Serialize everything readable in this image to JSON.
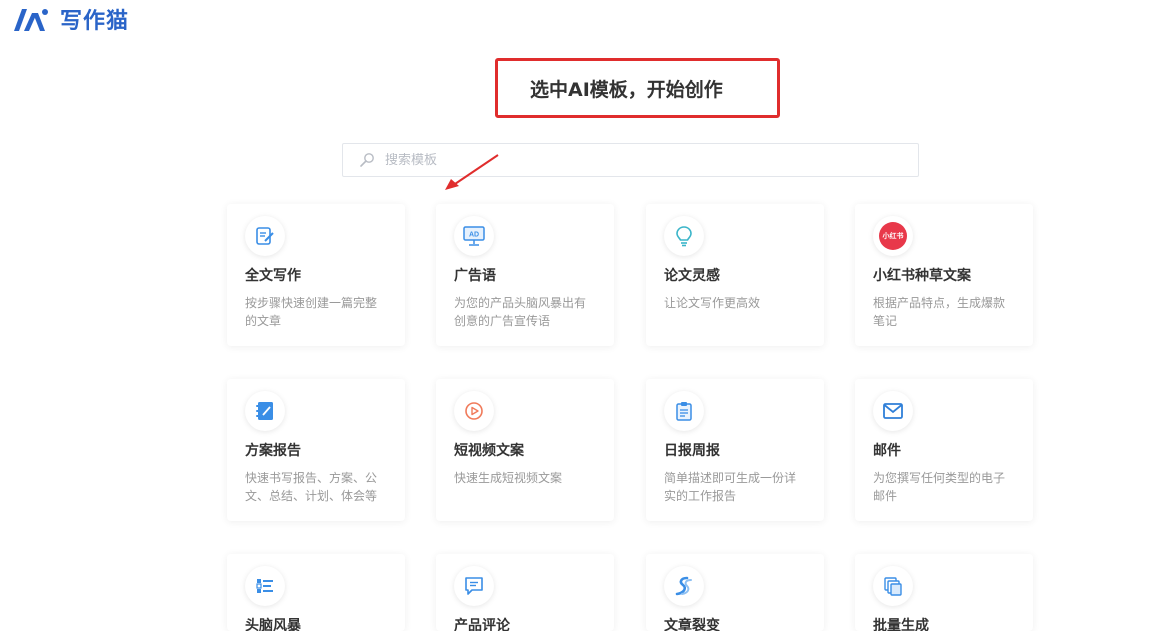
{
  "brand": {
    "name": "写作猫"
  },
  "callout": {
    "text": "选中AI模板，开始创作"
  },
  "search": {
    "placeholder": "搜索模板"
  },
  "templates": [
    {
      "title": "全文写作",
      "desc": "按步骤快速创建一篇完整的文章",
      "icon": "edit-document-icon"
    },
    {
      "title": "广告语",
      "desc": "为您的产品头脑风暴出有创意的广告宣传语",
      "icon": "ad-screen-icon"
    },
    {
      "title": "论文灵感",
      "desc": "让论文写作更高效",
      "icon": "lightbulb-icon"
    },
    {
      "title": "小红书种草文案",
      "desc": "根据产品特点，生成爆款笔记",
      "icon": "xiaohongshu-icon",
      "icon_text": "小红书"
    },
    {
      "title": "方案报告",
      "desc": "快速书写报告、方案、公文、总结、计划、体会等",
      "icon": "notebook-icon"
    },
    {
      "title": "短视频文案",
      "desc": "快速生成短视频文案",
      "icon": "play-icon"
    },
    {
      "title": "日报周报",
      "desc": "简单描述即可生成一份详实的工作报告",
      "icon": "clipboard-icon"
    },
    {
      "title": "邮件",
      "desc": "为您撰写任何类型的电子邮件",
      "icon": "mail-icon"
    },
    {
      "title": "头脑风暴",
      "desc": "",
      "icon": "list-icon"
    },
    {
      "title": "产品评论",
      "desc": "",
      "icon": "comment-icon"
    },
    {
      "title": "文章裂变",
      "desc": "",
      "icon": "split-icon"
    },
    {
      "title": "批量生成",
      "desc": "",
      "icon": "stack-copy-icon"
    }
  ],
  "colors": {
    "brand": "#2a64c8",
    "accent": "#3a8ee6",
    "callout_border": "#e02d2d",
    "xiaohongshu": "#e8384a"
  }
}
